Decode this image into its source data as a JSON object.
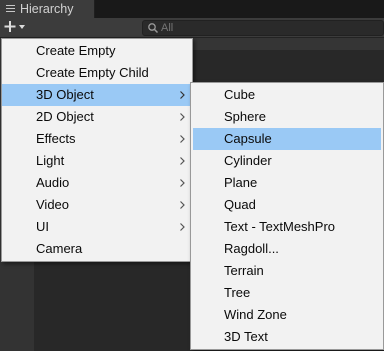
{
  "tab": {
    "title": "Hierarchy",
    "icon": "hamburger-menu-icon"
  },
  "toolbar": {
    "add_icon": "plus-icon",
    "dropdown_icon": "chevron-down-icon"
  },
  "search": {
    "icon": "search-icon",
    "placeholder": "All",
    "value": ""
  },
  "main_menu": {
    "items": [
      {
        "label": "Create Empty",
        "submenu": false,
        "highlighted": false
      },
      {
        "label": "Create Empty Child",
        "submenu": false,
        "highlighted": false
      },
      {
        "label": "3D Object",
        "submenu": true,
        "highlighted": true
      },
      {
        "label": "2D Object",
        "submenu": true,
        "highlighted": false
      },
      {
        "label": "Effects",
        "submenu": true,
        "highlighted": false
      },
      {
        "label": "Light",
        "submenu": true,
        "highlighted": false
      },
      {
        "label": "Audio",
        "submenu": true,
        "highlighted": false
      },
      {
        "label": "Video",
        "submenu": true,
        "highlighted": false
      },
      {
        "label": "UI",
        "submenu": true,
        "highlighted": false
      },
      {
        "label": "Camera",
        "submenu": false,
        "highlighted": false
      }
    ]
  },
  "sub_menu": {
    "items": [
      {
        "label": "Cube",
        "highlighted": false
      },
      {
        "label": "Sphere",
        "highlighted": false
      },
      {
        "label": "Capsule",
        "highlighted": true
      },
      {
        "label": "Cylinder",
        "highlighted": false
      },
      {
        "label": "Plane",
        "highlighted": false
      },
      {
        "label": "Quad",
        "highlighted": false
      },
      {
        "label": "Text - TextMeshPro",
        "highlighted": false
      },
      {
        "label": "Ragdoll...",
        "highlighted": false
      },
      {
        "label": "Terrain",
        "highlighted": false
      },
      {
        "label": "Tree",
        "highlighted": false
      },
      {
        "label": "Wind Zone",
        "highlighted": false
      },
      {
        "label": "3D Text",
        "highlighted": false
      }
    ]
  },
  "colors": {
    "highlight": "#9ac9f5",
    "menu_bg": "#f2f2f2",
    "editor_bg": "#282828",
    "toolbar_bg": "#3c3c3c"
  }
}
